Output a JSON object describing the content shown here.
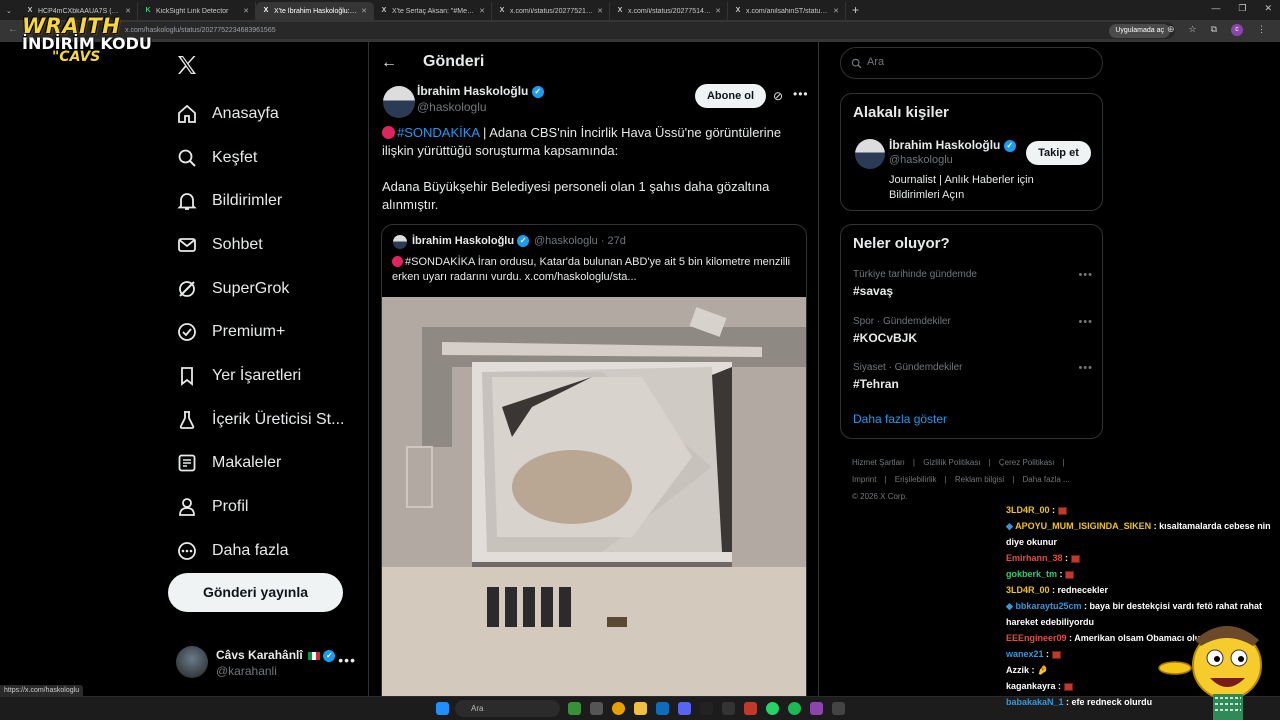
{
  "browser": {
    "tabs": [
      {
        "title": "HCP4mCXbkAAUA7S (1714×10",
        "favicon": "X"
      },
      {
        "title": "KickSight Link Detector",
        "favicon": "K"
      },
      {
        "title": "X'te İbrahim Haskoloğlu: \"🔴#",
        "favicon": "X",
        "active": true
      },
      {
        "title": "X'te Sertaç Aksan: \"#Medya İn",
        "favicon": "X"
      },
      {
        "title": "x.com/i/status/20277521447",
        "favicon": "X"
      },
      {
        "title": "x.com/i/status/20277514298",
        "favicon": "X"
      },
      {
        "title": "x.com/anilsahinST/status/2027",
        "favicon": "X"
      }
    ],
    "url": "x.com/haskologlu/status/2027752234683961565",
    "open_in_app": "Uygulamada aç",
    "status_url": "https://x.com/haskologlu"
  },
  "overlay_logo": {
    "line1": "WRAITH",
    "line2": "İNDİRİM KODU",
    "line3": "\"CAVS"
  },
  "nav": {
    "items": [
      {
        "label": "Anasayfa",
        "icon": "home-icon"
      },
      {
        "label": "Keşfet",
        "icon": "search-icon"
      },
      {
        "label": "Bildirimler",
        "icon": "bell-icon"
      },
      {
        "label": "Sohbet",
        "icon": "mail-icon"
      },
      {
        "label": "SuperGrok",
        "icon": "grok-icon"
      },
      {
        "label": "Premium+",
        "icon": "verified-badge-icon"
      },
      {
        "label": "Yer İşaretleri",
        "icon": "bookmark-icon"
      },
      {
        "label": "İçerik Üreticisi St...",
        "icon": "creator-studio-icon"
      },
      {
        "label": "Makaleler",
        "icon": "articles-icon"
      },
      {
        "label": "Profil",
        "icon": "person-icon"
      },
      {
        "label": "Daha fazla",
        "icon": "more-circle-icon"
      }
    ],
    "post_button": "Gönderi yayınla",
    "account": {
      "name": "Câvs Karahânlî",
      "handle": "@karahanli"
    }
  },
  "post": {
    "header_title": "Gönderi",
    "author_name": "İbrahim Haskoloğlu",
    "author_handle": "@haskologlu",
    "subscribe_label": "Abone ol",
    "hashtag": "#SONDAKİKA",
    "text_part1": " | Adana CBS'nin İncirlik Hava Üssü'ne görüntülerine ilişkin yürüttüğü soruşturma kapsamında:",
    "text_part2": "Adana Büyükşehir Belediyesi personeli olan 1 şahıs daha gözaltına alınmıştır.",
    "quote": {
      "author_name": "İbrahim Haskoloğlu",
      "author_handle": "@haskologlu · 27d",
      "text": "#SONDAKİKA İran ordusu, Katar'da bulunan ABD'ye ait 5 bin kilometre menzilli erken uyarı radarını vurdu.  x.com/haskologlu/sta..."
    }
  },
  "sidebar": {
    "search_placeholder": "Ara",
    "related": {
      "title": "Alakalı kişiler",
      "name": "İbrahim Haskoloğlu",
      "handle": "@haskologlu",
      "bio": "Journalist | Anlık Haberler için Bildirimleri Açın",
      "follow_label": "Takip et"
    },
    "trends": {
      "title": "Neler oluyor?",
      "items": [
        {
          "context": "Türkiye tarihinde gündemde",
          "name": "#savaş"
        },
        {
          "context": "Spor · Gündemdekiler",
          "name": "#KOCvBJK"
        },
        {
          "context": "Siyaset · Gündemdekiler",
          "name": "#Tehran"
        }
      ],
      "show_more": "Daha fazla göster"
    },
    "footer": [
      "Hizmet Şartları",
      "Gizlilik Politikası",
      "Çerez Politikası",
      "Imprint",
      "Erişilebilirlik",
      "Reklam bilgisi",
      "Daha fazla ...",
      "© 2026 X Corp."
    ]
  },
  "chat": [
    {
      "user": "3LD4R_00",
      "color": "#f1c40f",
      "msg": ""
    },
    {
      "user": "APOYU_MUM_ISIGINDA_SIKEN",
      "color": "#f1c40f",
      "msg": "kısaltamalarda cebese nin diye okunur"
    },
    {
      "user": "Emirhann_38",
      "color": "#e74c3c",
      "msg": ""
    },
    {
      "user": "gokberk_tm",
      "color": "#2ecc71",
      "msg": ""
    },
    {
      "user": "3LD4R_00",
      "color": "#f1c40f",
      "msg": "rednecekler"
    },
    {
      "user": "bbkaraytu25cm",
      "color": "#3498db",
      "msg": "baya bir destekçisi vardı fetö rahat rahat hareket edebiliyordu"
    },
    {
      "user": "EEEngineer09",
      "color": "#e74c3c",
      "msg": "Amerikan olsam Obamacı olurdum ben"
    },
    {
      "user": "wanex21",
      "color": "#3498db",
      "msg": ""
    },
    {
      "user": "Azzik",
      "color": "#ffffff",
      "msg": "🤌"
    },
    {
      "user": "kagankayra",
      "color": "#ffffff",
      "msg": ""
    },
    {
      "user": "babakakaN_1",
      "color": "#3498db",
      "msg": "efe redneck olurdu"
    }
  ],
  "taskbar": {
    "search_placeholder": "Ara"
  }
}
